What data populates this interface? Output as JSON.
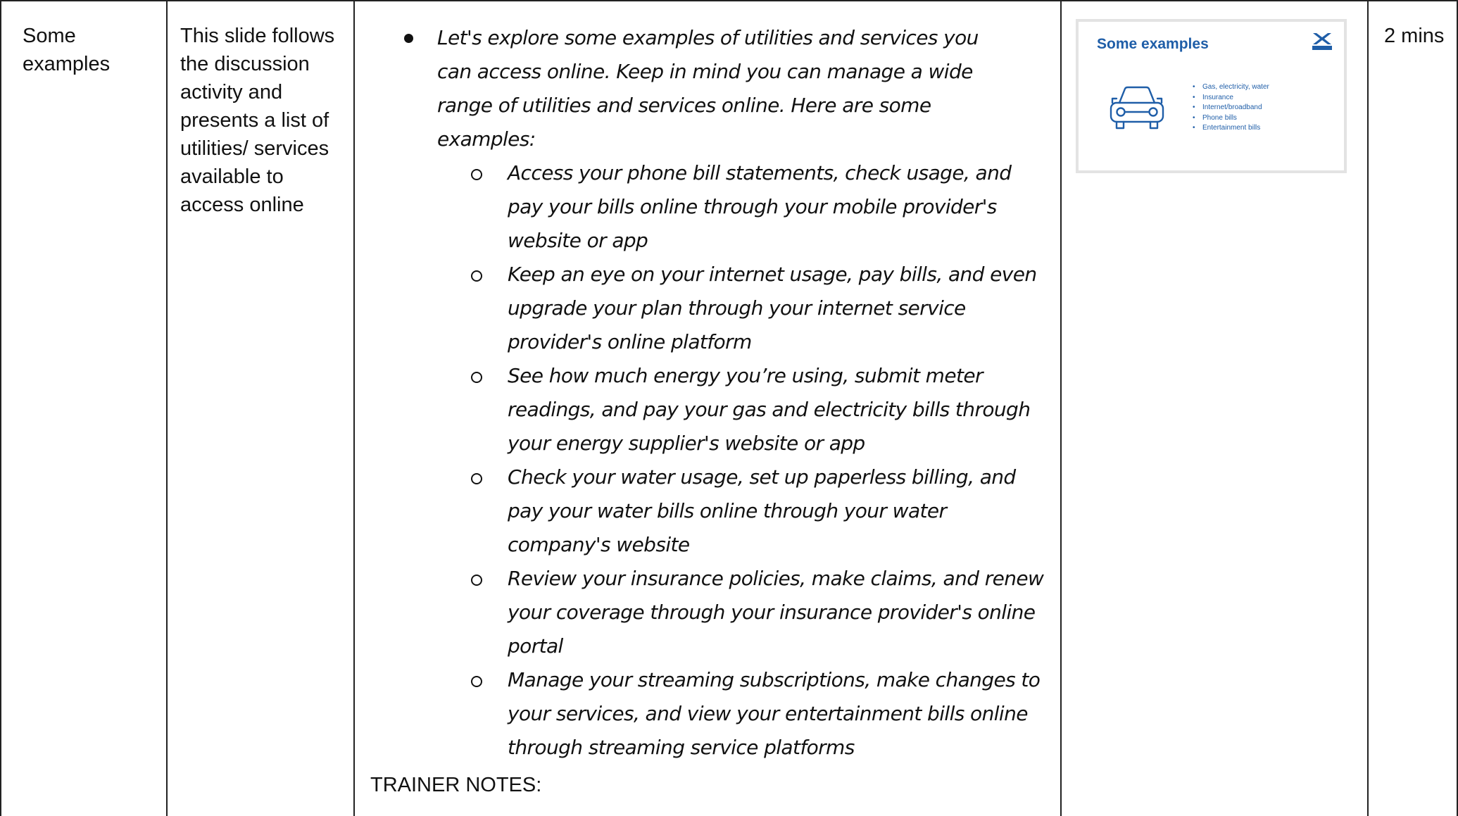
{
  "table": {
    "topic": "Some examples",
    "description": "This slide follows the discussion activity and presents a list of utilities/ services available to access online",
    "intro": "Let's explore some examples of utilities and services you can access online. Keep in mind you can manage a wide range of utilities and services online. Here are some examples:",
    "examples": [
      "Access your phone bill statements, check usage, and pay your bills online through your mobile provider's website or app",
      "Keep an eye on your internet usage, pay bills, and even upgrade your plan through your internet service provider's online platform",
      "See how much energy you’re using, submit meter readings, and pay your gas and electricity bills through your energy supplier's website or app",
      "Check your water usage, set up paperless billing, and pay your water bills online through your water company's website",
      "Review your insurance policies, make claims, and renew your coverage through your insurance provider's online portal",
      "Manage your streaming subscriptions, make changes to your services, and view your entertainment bills online through streaming service platforms"
    ],
    "trainer_notes_label": "TRAINER NOTES:",
    "duration": "2 mins"
  },
  "slide": {
    "title": "Some examples",
    "logo_text": "HALIFAX",
    "bullets": [
      "Gas, electricity, water",
      "Insurance",
      "Internet/broadband",
      "Phone bills",
      "Entertainment bills"
    ],
    "icon": "car-icon",
    "colors": {
      "accent": "#1f5ea8",
      "border": "#e3e3e3"
    }
  }
}
